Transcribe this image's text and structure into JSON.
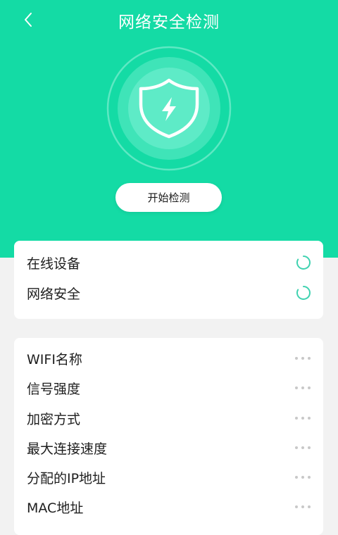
{
  "header": {
    "title": "网络安全检测",
    "back_icon": "chevron-left-icon"
  },
  "hero": {
    "icon": "shield-lightning-icon",
    "start_button": "开始检测"
  },
  "colors": {
    "accent": "#14dba5",
    "spinner": "#3fd2b0",
    "dots": "#c8c8c8"
  },
  "status_items": [
    {
      "label": "在线设备",
      "icon": "loading-spinner-icon"
    },
    {
      "label": "网络安全",
      "icon": "loading-spinner-icon"
    }
  ],
  "info_items": [
    {
      "label": "WIFI名称",
      "icon": "more-dots-icon"
    },
    {
      "label": "信号强度",
      "icon": "more-dots-icon"
    },
    {
      "label": "加密方式",
      "icon": "more-dots-icon"
    },
    {
      "label": "最大连接速度",
      "icon": "more-dots-icon"
    },
    {
      "label": "分配的IP地址",
      "icon": "more-dots-icon"
    },
    {
      "label": "MAC地址",
      "icon": "more-dots-icon"
    }
  ]
}
